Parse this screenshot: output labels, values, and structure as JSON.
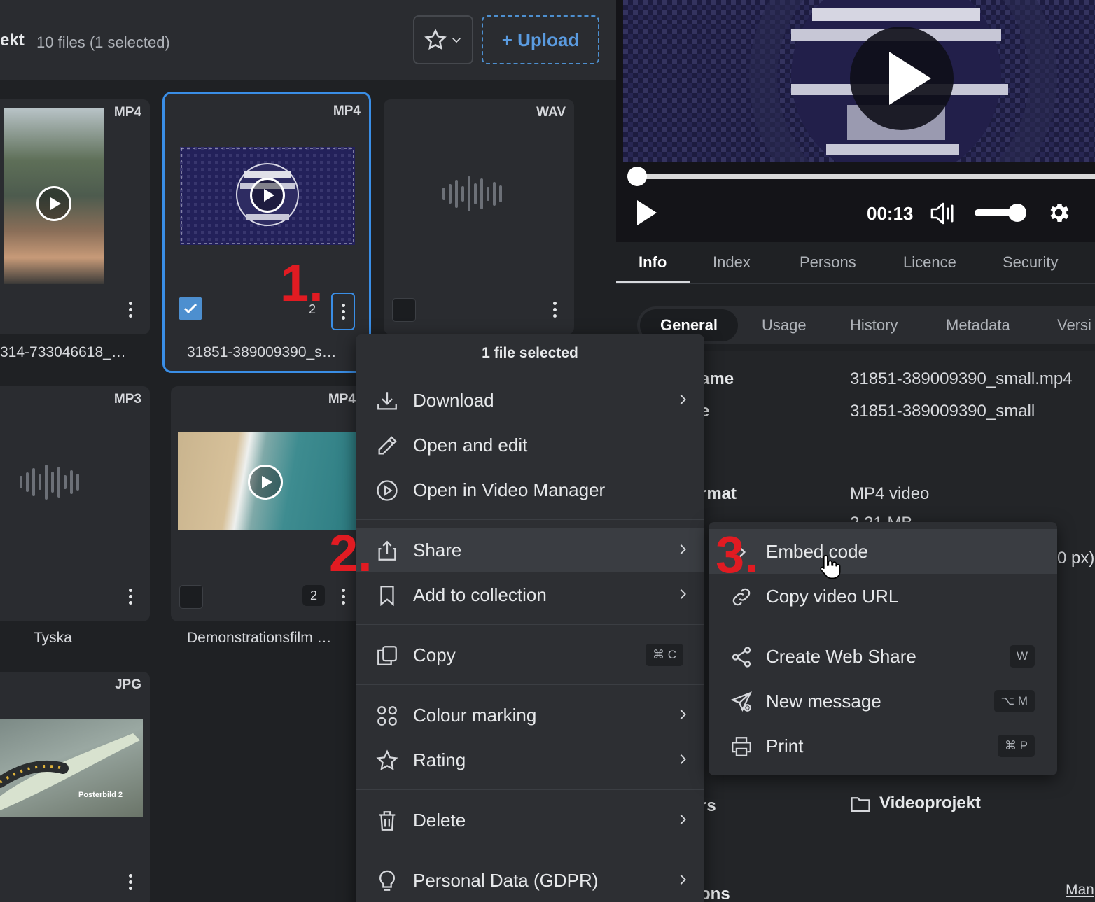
{
  "header": {
    "breadcrumb": "ekt",
    "file_count": "10 files (1 selected)",
    "upload_label": "+ Upload"
  },
  "files": [
    {
      "type": "MP4",
      "name": "314-733046618_…"
    },
    {
      "type": "MP4",
      "name": "31851-389009390_s…",
      "version_count": "2"
    },
    {
      "type": "WAV",
      "name": ""
    },
    {
      "type": "MP3",
      "name": "Tyska"
    },
    {
      "type": "MP4",
      "name": "Demonstrationsfilm …",
      "version_count": "2"
    },
    {
      "type": "JPG",
      "name": "",
      "thumb_caption": "Posterbild 2"
    }
  ],
  "player": {
    "time": "00:13",
    "progress": 0.0,
    "volume": 0.9
  },
  "detail_tabs": [
    "Info",
    "Index",
    "Persons",
    "Licence",
    "Security"
  ],
  "active_detail_tab": "Info",
  "sub_tabs": [
    "General",
    "Usage",
    "History",
    "Metadata",
    "Versi"
  ],
  "active_sub_tab": "General",
  "info": {
    "name_label": "ame",
    "name_value": "31851-389009390_small.mp4",
    "title_label": "e",
    "title_value": "31851-389009390_small",
    "format_label": "rmat",
    "format_value": "MP4 video",
    "size_fragment": "2.21 MB",
    "dims_fragment": "0 px)",
    "folders_label": "rs",
    "folder_value": "Videoprojekt",
    "collections_label": "ons",
    "manage_link": "Man"
  },
  "context_menu": {
    "header": "1 file selected",
    "items": [
      {
        "label": "Download",
        "icon": "download-icon",
        "submenu": true
      },
      {
        "label": "Open and edit",
        "icon": "pencil-icon"
      },
      {
        "label": "Open in Video Manager",
        "icon": "play-circle-icon"
      },
      {
        "label": "Share",
        "icon": "share-icon",
        "submenu": true
      },
      {
        "label": "Add to collection",
        "icon": "bookmark-icon",
        "submenu": true
      },
      {
        "label": "Copy",
        "icon": "copy-icon",
        "shortcut": "⌘ C"
      },
      {
        "label": "Colour marking",
        "icon": "colour-dots-icon",
        "submenu": true
      },
      {
        "label": "Rating",
        "icon": "star-icon",
        "submenu": true
      },
      {
        "label": "Delete",
        "icon": "trash-icon",
        "submenu": true
      },
      {
        "label": "Personal Data (GDPR)",
        "icon": "lightbulb-icon",
        "submenu": true
      }
    ]
  },
  "share_submenu": {
    "items": [
      {
        "label": "Embed code",
        "icon": "code-icon"
      },
      {
        "label": "Copy video URL",
        "icon": "link-icon"
      },
      {
        "label": "Create Web Share",
        "icon": "share-nodes-icon",
        "shortcut": "W"
      },
      {
        "label": "New message",
        "icon": "send-icon",
        "shortcut": "⌥ M"
      },
      {
        "label": "Print",
        "icon": "printer-icon",
        "shortcut": "⌘ P"
      }
    ]
  },
  "steps": [
    "1.",
    "2.",
    "3."
  ],
  "colors": {
    "accent": "#3a8ee6",
    "step_red": "#e11b22",
    "bg": "#1f2124",
    "panel": "#2a2c30"
  }
}
